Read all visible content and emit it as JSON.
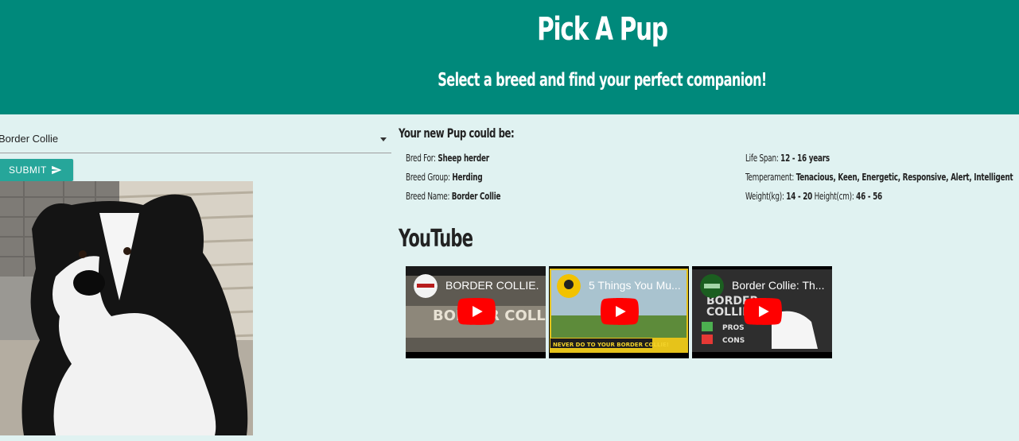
{
  "header": {
    "title": "Pick A Pup",
    "subtitle": "Select a breed and find your perfect companion!"
  },
  "form": {
    "selected_breed": "Border Collie",
    "submit_label": "SUBMIT"
  },
  "result": {
    "heading": "Your new Pup could be:",
    "bred_for_label": "Bred For:",
    "bred_for": "Sheep herder",
    "breed_group_label": "Breed Group:",
    "breed_group": "Herding",
    "breed_name_label": "Breed Name:",
    "breed_name": "Border Collie",
    "life_span_label": "Life Span:",
    "life_span": "12 - 16 years",
    "temperament_label": "Temperament:",
    "temperament": "Tenacious, Keen, Energetic, Responsive, Alert, Intelligent",
    "weight_label": "Weight(kg):",
    "weight": "14 - 20",
    "height_label": "Height(cm):",
    "height": "46 - 56"
  },
  "youtube": {
    "heading": "YouTube",
    "videos": [
      {
        "title": "BORDER COLLIE..."
      },
      {
        "title": "5 Things You Mu..."
      },
      {
        "title": "Border Collie: Th..."
      }
    ],
    "thumb_texts": {
      "v1_overlay": "BORDER COLLIES",
      "v2_banner": "NEVER DO TO YOUR BORDER COLLIE!",
      "v3_line1": "BORDER",
      "v3_line2": "COLLIE",
      "v3_pros": "PROS",
      "v3_cons": "CONS"
    }
  },
  "colors": {
    "header_bg": "#00897b",
    "page_bg": "#e0f2f1",
    "button_bg": "#26a69a",
    "play_red": "#ff0000"
  }
}
